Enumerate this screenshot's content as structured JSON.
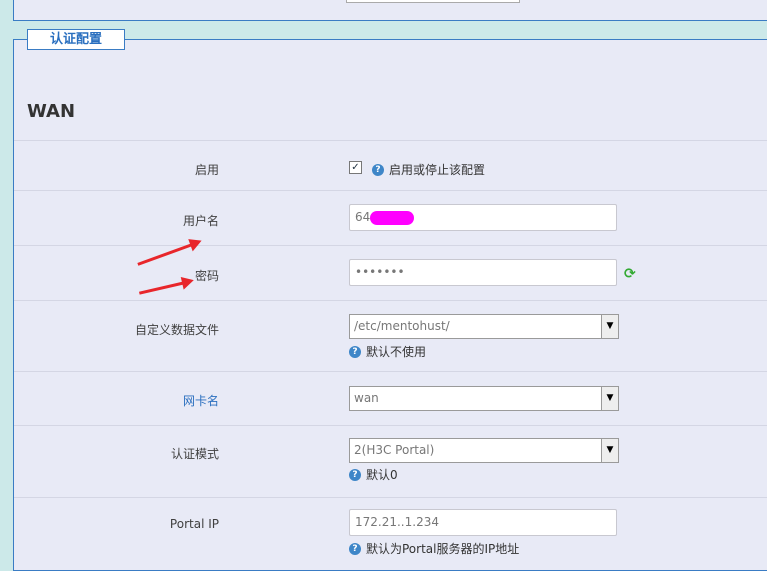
{
  "section": {
    "legend": "认证配置",
    "title": "WAN"
  },
  "fields": {
    "enable": {
      "label": "启用",
      "help": "启用或停止该配置",
      "checked": true
    },
    "username": {
      "label": "用户名",
      "value": "64"
    },
    "password": {
      "label": "密码",
      "value": "•••••••"
    },
    "datafile": {
      "label": "自定义数据文件",
      "value": "/etc/mentohust/",
      "help": "默认不使用"
    },
    "nic": {
      "label": "网卡名",
      "value": "wan"
    },
    "mode": {
      "label": "认证模式",
      "value": "2(H3C Portal)",
      "help": "默认0"
    },
    "portal": {
      "label": "Portal IP",
      "value": "172.21..1.234",
      "help": "默认为Portal服务器的IP地址"
    }
  }
}
